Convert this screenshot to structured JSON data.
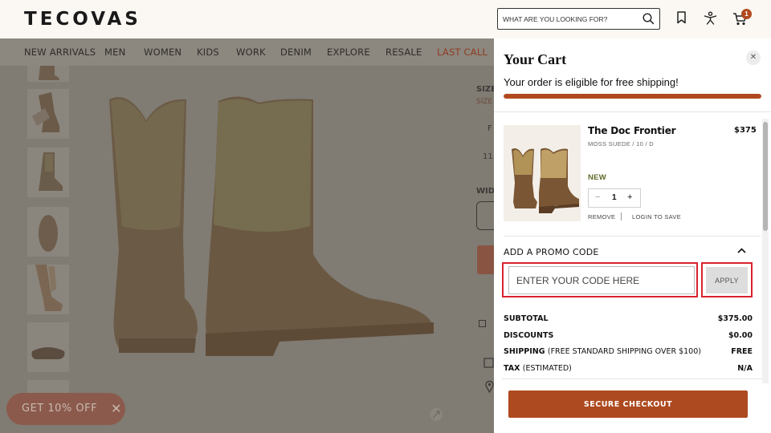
{
  "header": {
    "logo": "TECOVAS",
    "search_placeholder": "WHAT ARE YOU LOOKING FOR?",
    "cart_count": "1"
  },
  "nav": {
    "items": [
      "NEW ARRIVALS",
      "MEN",
      "WOMEN",
      "KIDS",
      "WORK",
      "DENIM",
      "EXPLORE",
      "RESALE",
      "LAST CALL"
    ]
  },
  "product_page": {
    "size_label": "SIZE",
    "size_sub": "SIZE",
    "size_f": "F",
    "size_115": "11.5",
    "width_label": "WIDT",
    "promo_pill": "GET 10% OFF"
  },
  "cart": {
    "title": "Your Cart",
    "shipping_message": "Your order is eligible for free shipping!",
    "shipping_progress": 1.0,
    "item": {
      "name": "The Doc Frontier",
      "price": "$375",
      "variant": "MOSS SUEDE / 10 / D",
      "tag": "NEW",
      "quantity": "1",
      "qty_minus": "−",
      "qty_plus": "+",
      "remove_label": "REMOVE",
      "save_label": "LOGIN TO SAVE"
    },
    "promo": {
      "heading": "ADD A PROMO CODE",
      "placeholder": "ENTER YOUR CODE HERE",
      "apply_label": "APPLY"
    },
    "summary": {
      "subtotal_label": "SUBTOTAL",
      "subtotal_value": "$375.00",
      "discounts_label": "DISCOUNTS",
      "discounts_value": "$0.00",
      "shipping_label": "SHIPPING",
      "shipping_note": "(FREE STANDARD SHIPPING OVER $100)",
      "shipping_value": "FREE",
      "tax_label": "TAX",
      "tax_note": "(ESTIMATED)",
      "tax_value": "N/A"
    },
    "checkout_label": "SECURE CHECKOUT"
  }
}
